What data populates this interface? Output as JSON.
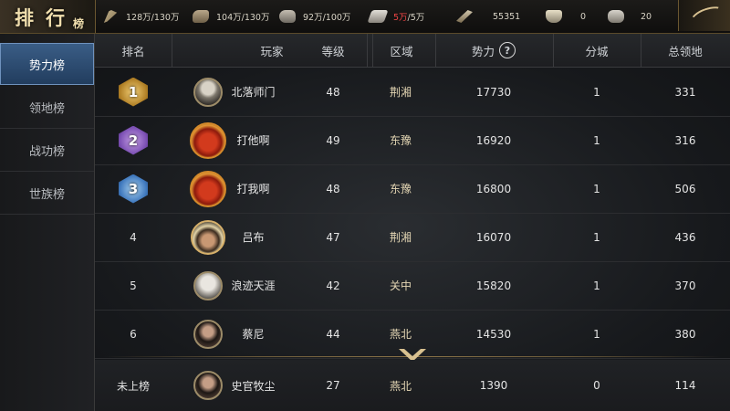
{
  "title": {
    "c1": "排",
    "c2": "行",
    "c3": "榜"
  },
  "resources": [
    {
      "icon": "wheat-icon",
      "value": "128万/130万"
    },
    {
      "icon": "wood-icon",
      "value": "104万/130万"
    },
    {
      "icon": "stone-icon",
      "value": "92万/100万"
    },
    {
      "icon": "iron-icon",
      "value_warn": "5万",
      "value_rest": "/5万"
    },
    {
      "icon": "order-icon",
      "value": "55351"
    },
    {
      "icon": "copper-icon",
      "value": "0"
    },
    {
      "icon": "jade-icon",
      "value": "20"
    }
  ],
  "tabs": [
    "势力榜",
    "领地榜",
    "战功榜",
    "世族榜"
  ],
  "active_tab": 0,
  "headers": {
    "rank": "排名",
    "player": "玩家",
    "level": "等级",
    "region": "区域",
    "power": "势力",
    "help": "?",
    "branch": "分城",
    "territory": "总领地"
  },
  "rows": [
    {
      "rank": "1",
      "name": "北落师门",
      "level": "48",
      "region": "荆湘",
      "power": "17730",
      "branch": "1",
      "territory": "331"
    },
    {
      "rank": "2",
      "name": "打他啊",
      "level": "49",
      "region": "东豫",
      "power": "16920",
      "branch": "1",
      "territory": "316"
    },
    {
      "rank": "3",
      "name": "打我啊",
      "level": "48",
      "region": "东豫",
      "power": "16800",
      "branch": "1",
      "territory": "506"
    },
    {
      "rank": "4",
      "name": "吕布",
      "level": "47",
      "region": "荆湘",
      "power": "16070",
      "branch": "1",
      "territory": "436"
    },
    {
      "rank": "5",
      "name": "浪迹天涯",
      "level": "42",
      "region": "关中",
      "power": "15820",
      "branch": "1",
      "territory": "370"
    },
    {
      "rank": "6",
      "name": "蔡尼",
      "level": "44",
      "region": "燕北",
      "power": "14530",
      "branch": "1",
      "territory": "380"
    }
  ],
  "self": {
    "rank": "未上榜",
    "name": "史官牧尘",
    "level": "27",
    "region": "燕北",
    "power": "1390",
    "branch": "0",
    "territory": "114"
  },
  "colors": {
    "active_tab": "#2f5279",
    "gold": "#d8c190",
    "warn": "#e44444"
  }
}
